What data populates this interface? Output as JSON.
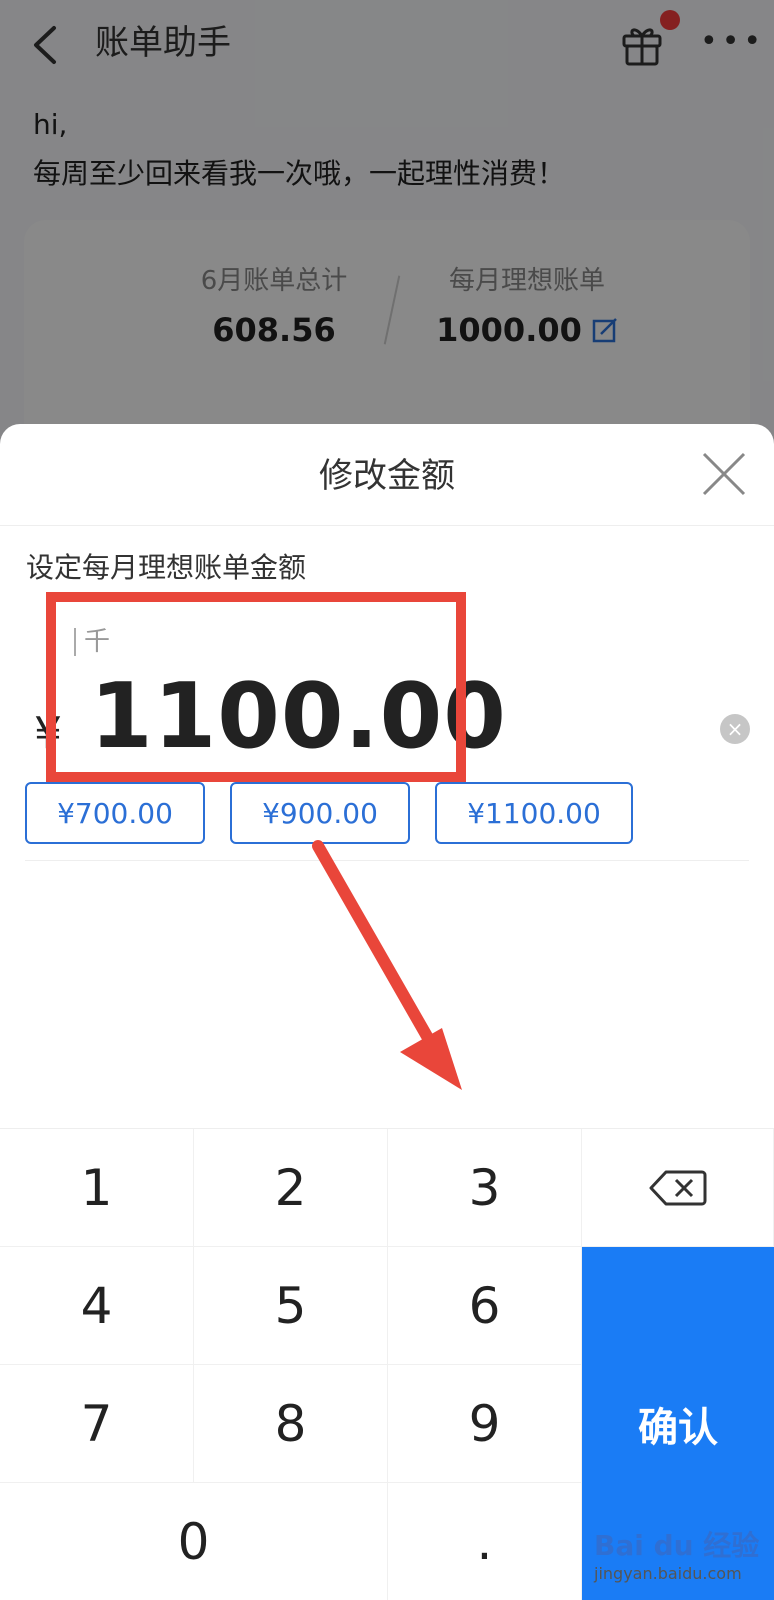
{
  "nav": {
    "back_glyph": "<",
    "title": "账单助手",
    "more_glyph": "•••"
  },
  "greeting": {
    "line1": "hi,",
    "line2": "每周至少回来看我一次哦，一起理性消费！"
  },
  "summary": {
    "left_label": "6月账单总计",
    "left_value": "608.56",
    "right_label": "每月理想账单",
    "right_value": "1000.00"
  },
  "sheet": {
    "title": "修改金额",
    "subtitle": "设定每月理想账单金额",
    "unit_hint": "千",
    "currency": "¥",
    "amount": "1100.00",
    "clear_glyph": "×",
    "presets": [
      "¥700.00",
      "¥900.00",
      "¥1100.00"
    ]
  },
  "keypad": {
    "keys": [
      "1",
      "2",
      "3",
      "4",
      "5",
      "6",
      "7",
      "8",
      "9",
      "0",
      "."
    ],
    "confirm": "确认"
  },
  "watermark": {
    "brand": "Bai du 经验",
    "url": "jingyan.baidu.com"
  },
  "colors": {
    "accent": "#1a7cf5",
    "annotation_red": "#e9463a",
    "preset_blue": "#2b6fd6",
    "badge_red": "#f23b3b"
  }
}
